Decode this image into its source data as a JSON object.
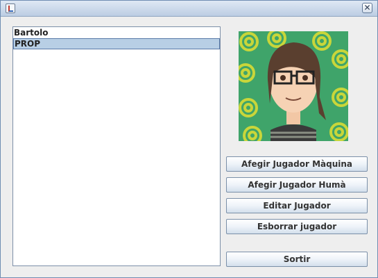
{
  "window": {
    "title": ""
  },
  "players": [
    "Bartolo",
    "PROP"
  ],
  "selected_player": "PROP",
  "buttons": {
    "add_machine": "Afegir Jugador Màquina",
    "add_human": "Afegir Jugador Humà",
    "edit": "Editar Jugador",
    "delete": "Esborrar jugador",
    "exit": "Sortir"
  },
  "icons": {
    "app": "java-app-icon",
    "close": "close-icon",
    "avatar": "player-avatar-image"
  },
  "colors": {
    "selection": "#b8cfe5",
    "titlebar": "#c7d5e8",
    "avatar_background": "#3fa46a"
  }
}
